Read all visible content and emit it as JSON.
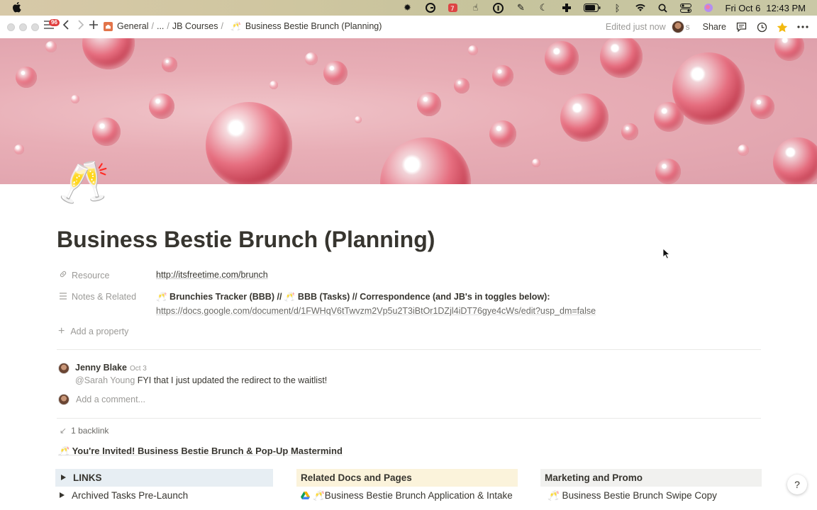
{
  "menubar": {
    "clock_day": "Fri Oct 6",
    "clock_time": "12:43 PM"
  },
  "topbar": {
    "badge_count": "96",
    "breadcrumbs": [
      "General",
      "...",
      "JB Courses",
      "Business Bestie Brunch (Planning)"
    ],
    "breadcrumb_icons": [
      "house-icon",
      "champagne-icon"
    ],
    "edited": "Edited just now",
    "presence_initial": "s",
    "share": "Share"
  },
  "page": {
    "icon": "🥂",
    "title": "Business Bestie Brunch (Planning)",
    "properties": [
      {
        "name": "Resource",
        "icon": "link-icon",
        "value": "http://itsfreetime.com/brunch"
      },
      {
        "name": "Notes & Related",
        "icon": "lines-icon",
        "value_line1": "🥂 Brunchies Tracker (BBB) // 🥂 BBB (Tasks) // Correspondence (and JB's in toggles below):",
        "value_line2": "https://docs.google.com/document/d/1FWHqV6tTwvzm2Vp5u2T3iBtOr1DZjl4iDT76gye4cWs/edit?usp_dm=false"
      }
    ],
    "add_property": "Add a property"
  },
  "comments": {
    "author": "Jenny Blake",
    "date": "Oct 3",
    "mention": "@Sarah Young",
    "body": " FYI that I just updated the redirect to the waitlist!",
    "add_placeholder": "Add a comment..."
  },
  "backlinks": {
    "label": "1 backlink",
    "invited": "🥂 You're Invited! Business Bestie Brunch & Pop-Up Mastermind"
  },
  "columns": [
    {
      "heading": "LINKS",
      "bg": "#e7eef3",
      "item": "Archived Tasks Pre-Launch"
    },
    {
      "heading": "Related Docs and Pages",
      "bg": "#fbf3db",
      "item": "🥂Business Bestie Brunch Application & Intake"
    },
    {
      "heading": "Marketing and Promo",
      "bg": "#f1f1ef",
      "item": "🥂 Business Bestie Brunch Swipe Copy"
    }
  ],
  "help": "?"
}
